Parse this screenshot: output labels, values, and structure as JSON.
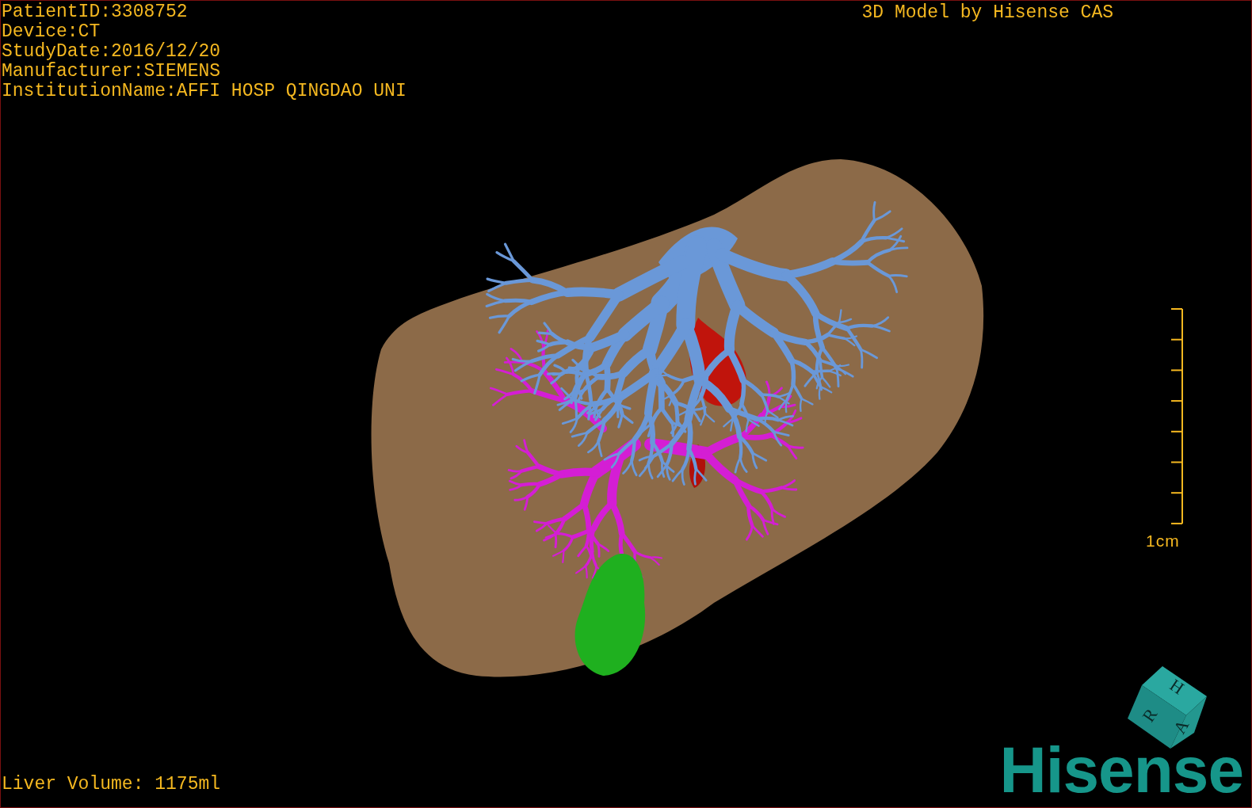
{
  "info_lines": [
    "PatientID:3308752",
    "Device:CT",
    "StudyDate:2016/12/20",
    "Manufacturer:SIEMENS",
    "InstitutionName:AFFI HOSP QINGDAO UNI"
  ],
  "title": "3D Model by Hisense CAS",
  "scale_bar": {
    "label": "1cm"
  },
  "orientation_cube": {
    "faces": [
      "H",
      "R",
      "A"
    ]
  },
  "volume": "Liver Volume: 1175ml",
  "logo": "Hisense"
}
